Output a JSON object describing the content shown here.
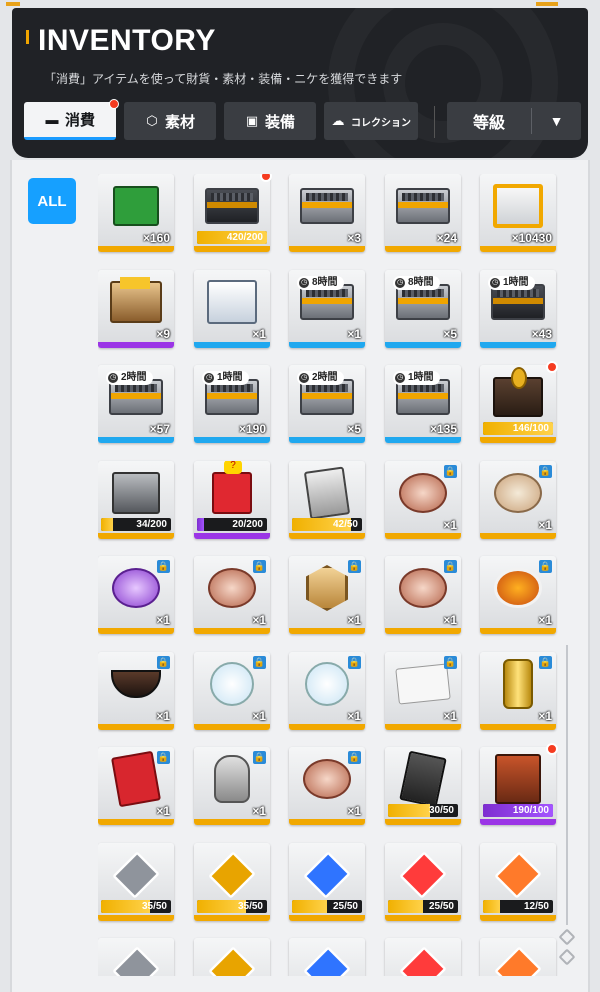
{
  "header": {
    "title": "INVENTORY",
    "subtitle": "「消費」アイテムを使って財貨・素材・装備・ニケを獲得できます",
    "tabs": [
      {
        "label": "消費",
        "icon": "consumable-icon",
        "active": true
      },
      {
        "label": "素材",
        "icon": "material-icon",
        "active": false
      },
      {
        "label": "装備",
        "icon": "equipment-icon",
        "active": false
      },
      {
        "label": "コレクション",
        "icon": "collection-icon",
        "active": false
      }
    ],
    "sort": {
      "label": "等級",
      "icon": "triangle-down-icon"
    }
  },
  "filter": {
    "all_label": "ALL"
  },
  "colors": {
    "accent_blue": "#16a0ff",
    "gold": "#f1a800",
    "purple": "#9b35e6",
    "blue": "#20a8ef",
    "notify_red": "#f53b20",
    "header_bg": "#202226"
  },
  "items": [
    {
      "name": "gift-bundle",
      "rarity": "gold",
      "count": "×160",
      "art": "bundle"
    },
    {
      "name": "black-case",
      "rarity": "gold",
      "bar": "420/200",
      "progress": 1.0,
      "dot": true,
      "art": "darkcase"
    },
    {
      "name": "gold-case",
      "rarity": "gold",
      "count": "×3",
      "art": "case"
    },
    {
      "name": "silver-gold-case",
      "rarity": "gold",
      "count": "×24",
      "art": "case"
    },
    {
      "name": "orange-crate",
      "rarity": "gold",
      "count": "×10430",
      "art": "orangebox"
    },
    {
      "name": "cardboard-box",
      "rarity": "purple",
      "count": "×9",
      "art": "cardboard"
    },
    {
      "name": "white-crate",
      "rarity": "blue",
      "count": "×1",
      "art": "whitebox"
    },
    {
      "name": "8h-case-a",
      "rarity": "blue",
      "count": "×1",
      "timer": "8時間",
      "art": "case"
    },
    {
      "name": "8h-case-b",
      "rarity": "blue",
      "count": "×5",
      "timer": "8時間",
      "art": "case"
    },
    {
      "name": "1h-case",
      "rarity": "blue",
      "count": "×43",
      "timer": "1時間",
      "art": "darkcase"
    },
    {
      "name": "2h-case-a",
      "rarity": "blue",
      "count": "×57",
      "timer": "2時間",
      "art": "case"
    },
    {
      "name": "1h-case-b",
      "rarity": "blue",
      "count": "×190",
      "timer": "1時間",
      "art": "case"
    },
    {
      "name": "2h-case-b",
      "rarity": "blue",
      "count": "×5",
      "timer": "2時間",
      "art": "case"
    },
    {
      "name": "1h-case-c",
      "rarity": "blue",
      "count": "×135",
      "timer": "1時間",
      "art": "case"
    },
    {
      "name": "gold-coin-chest",
      "rarity": "gold",
      "bar": "146/100",
      "progress": 1.0,
      "dot": true,
      "art": "chest"
    },
    {
      "name": "grey-crate",
      "rarity": "gold",
      "bar": "34/200",
      "progress": 0.17,
      "art": "greybox"
    },
    {
      "name": "mystery-box",
      "rarity": "purple",
      "bar": "20/200",
      "progress": 0.1,
      "art": "redbox"
    },
    {
      "name": "card-pack",
      "rarity": "gold",
      "bar": "42/50",
      "progress": 0.84,
      "art": "card"
    },
    {
      "name": "cake-doll",
      "rarity": "gold",
      "count": "×1",
      "lock": true,
      "art": "cake"
    },
    {
      "name": "dumplings",
      "rarity": "gold",
      "count": "×1",
      "lock": true,
      "art": "bowl"
    },
    {
      "name": "purple-jelly",
      "rarity": "gold",
      "count": "×1",
      "lock": true,
      "art": "jelly"
    },
    {
      "name": "choco-cake",
      "rarity": "gold",
      "count": "×1",
      "lock": true,
      "art": "cake"
    },
    {
      "name": "gold-medal",
      "rarity": "gold",
      "count": "×1",
      "lock": true,
      "art": "medal"
    },
    {
      "name": "cake-15",
      "rarity": "gold",
      "count": "×1",
      "lock": true,
      "art": "cake"
    },
    {
      "name": "orange-plate",
      "rarity": "gold",
      "count": "×1",
      "lock": true,
      "art": "plate"
    },
    {
      "name": "hot-pot",
      "rarity": "gold",
      "count": "×1",
      "lock": true,
      "art": "pot"
    },
    {
      "name": "keychain-a",
      "rarity": "gold",
      "count": "×1",
      "lock": true,
      "art": "keychain"
    },
    {
      "name": "keychain-b",
      "rarity": "gold",
      "count": "×1",
      "lock": true,
      "art": "keychain"
    },
    {
      "name": "letter",
      "rarity": "gold",
      "count": "×1",
      "lock": true,
      "art": "letter"
    },
    {
      "name": "gold-can",
      "rarity": "gold",
      "count": "×1",
      "lock": true,
      "art": "can"
    },
    {
      "name": "red-notebook",
      "rarity": "gold",
      "count": "×1",
      "lock": true,
      "art": "notebook"
    },
    {
      "name": "stone-figure",
      "rarity": "gold",
      "count": "×1",
      "lock": true,
      "art": "figure"
    },
    {
      "name": "layer-cake",
      "rarity": "gold",
      "count": "×1",
      "lock": true,
      "art": "cake"
    },
    {
      "name": "dark-card",
      "rarity": "gold",
      "bar": "30/50",
      "progress": 0.6,
      "art": "darkcard"
    },
    {
      "name": "rust-chest",
      "rarity": "purple",
      "bar": "190/100",
      "progress": 1.0,
      "dot": true,
      "art": "rustbox"
    },
    {
      "name": "ssr-gem-silver",
      "rarity": "gold",
      "bar": "35/50",
      "progress": 0.7,
      "art": "gem",
      "gem_color": "#8f949c"
    },
    {
      "name": "ssr-gem-gold",
      "rarity": "gold",
      "bar": "35/50",
      "progress": 0.7,
      "art": "gem",
      "gem_color": "#e8a400"
    },
    {
      "name": "ssr-gem-blue",
      "rarity": "gold",
      "bar": "25/50",
      "progress": 0.5,
      "art": "gem",
      "gem_color": "#2f74ff"
    },
    {
      "name": "ssr-gem-red",
      "rarity": "gold",
      "bar": "25/50",
      "progress": 0.5,
      "art": "gem",
      "gem_color": "#ff3b3b"
    },
    {
      "name": "ssr-gem-orange",
      "rarity": "gold",
      "bar": "12/50",
      "progress": 0.24,
      "art": "gem",
      "gem_color": "#ff7a2a"
    },
    {
      "name": "gem-partial-silver",
      "rarity": "gold",
      "art": "gem",
      "gem_color": "#8f949c"
    },
    {
      "name": "gem-partial-gold",
      "rarity": "gold",
      "art": "gem",
      "gem_color": "#e8a400"
    },
    {
      "name": "gem-partial-blue",
      "rarity": "gold",
      "art": "gem",
      "gem_color": "#2f74ff"
    },
    {
      "name": "gem-partial-red",
      "rarity": "gold",
      "art": "gem",
      "gem_color": "#ff3b3b"
    },
    {
      "name": "gem-partial-orange",
      "rarity": "gold",
      "art": "gem",
      "gem_color": "#ff7a2a"
    }
  ]
}
